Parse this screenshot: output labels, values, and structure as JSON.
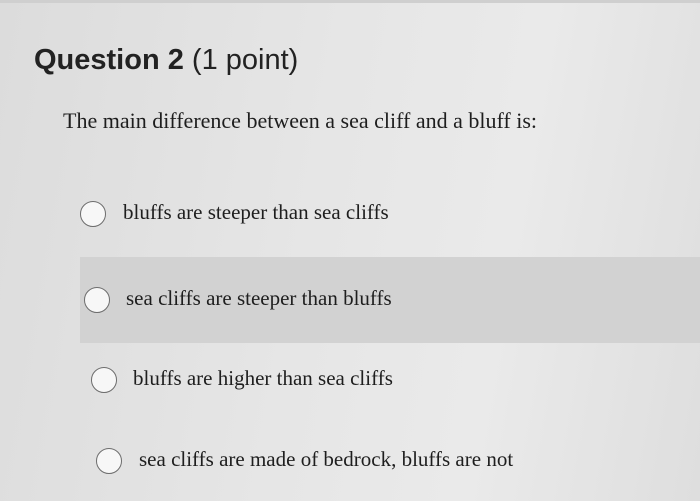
{
  "question": {
    "title_number": "Question 2",
    "title_points": " (1 point)",
    "prompt": "The main difference between a sea cliff and a bluff is:",
    "options": [
      {
        "label": "bluffs are steeper than sea cliffs",
        "selected": false
      },
      {
        "label": "sea cliffs are steeper than bluffs",
        "selected": false,
        "highlighted": true
      },
      {
        "label": "bluffs are higher than sea cliffs",
        "selected": false
      },
      {
        "label": "sea cliffs are made of bedrock, bluffs are not",
        "selected": false
      }
    ]
  }
}
